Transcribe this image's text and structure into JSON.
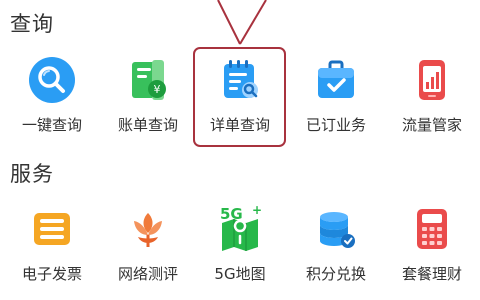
{
  "sections": {
    "query": {
      "title": "查询",
      "items": [
        {
          "label": "一键查询",
          "icon": "search-icon"
        },
        {
          "label": "账单查询",
          "icon": "bill-icon"
        },
        {
          "label": "详单查询",
          "icon": "detail-list-icon"
        },
        {
          "label": "已订业务",
          "icon": "briefcase-icon"
        },
        {
          "label": "流量管家",
          "icon": "phone-chart-icon"
        }
      ]
    },
    "service": {
      "title": "服务",
      "items": [
        {
          "label": "电子发票",
          "icon": "invoice-icon"
        },
        {
          "label": "网络测评",
          "icon": "flower-icon"
        },
        {
          "label": "5G地图",
          "icon": "5g-map-icon"
        },
        {
          "label": "积分兑换",
          "icon": "coins-icon"
        },
        {
          "label": "套餐理财",
          "icon": "calculator-icon"
        }
      ]
    }
  },
  "badges": {
    "five_g": "5G"
  },
  "colors": {
    "highlight": "#a8323e",
    "blue": "#1e90e8",
    "green": "#27b84a",
    "orange": "#f5a623",
    "red": "#ea4b4b"
  }
}
